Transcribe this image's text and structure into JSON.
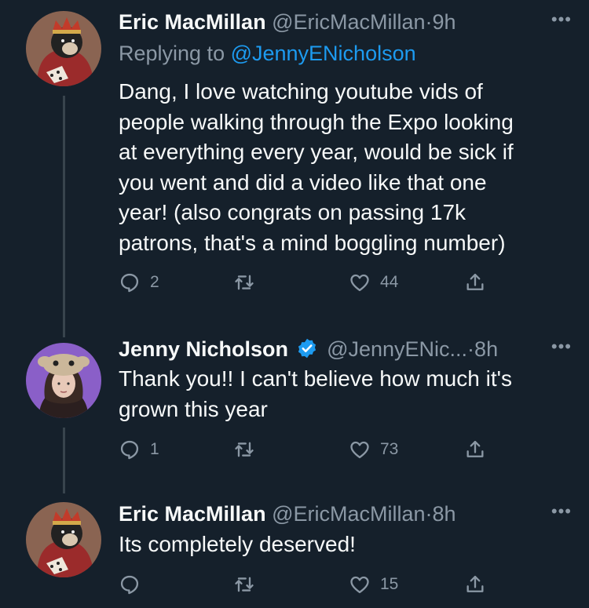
{
  "tweets": [
    {
      "name": "Eric MacMillan",
      "handle": "@EricMacMillan",
      "separator": "·",
      "time": "9h",
      "replying_prefix": "Replying to ",
      "replying_to": "@JennyENicholson",
      "text_lines": [
        "Dang, I love watching youtube vids of",
        "people walking through the Expo looking",
        "at everything every year, would be sick if",
        "you went and did a video like that one",
        "year! (also congrats on passing 17k",
        "patrons, that's a mind boggling number)"
      ],
      "replies": "2",
      "retweets": "",
      "likes": "44"
    },
    {
      "name": "Jenny Nicholson",
      "verified": true,
      "handle": "@JennyENic...",
      "separator": "·",
      "time": "8h",
      "text_lines": [
        "Thank you!! I can't believe how much it's",
        "grown this year"
      ],
      "replies": "1",
      "retweets": "",
      "likes": "73"
    },
    {
      "name": "Eric MacMillan",
      "handle": "@EricMacMillan",
      "separator": "·",
      "time": "8h",
      "text_lines": [
        "Its completely deserved!"
      ],
      "replies": "",
      "retweets": "",
      "likes": "15"
    }
  ],
  "more_label": "•••",
  "icons": {
    "reply": "reply-icon",
    "retweet": "retweet-icon",
    "like": "heart-icon",
    "share": "share-icon",
    "more": "more-icon",
    "verified": "verified-badge-icon"
  },
  "colors": {
    "background": "#15202b",
    "text": "#f7f9f9",
    "secondary": "#8b98a5",
    "link": "#1d9bf0",
    "thread_line": "#38444d"
  }
}
